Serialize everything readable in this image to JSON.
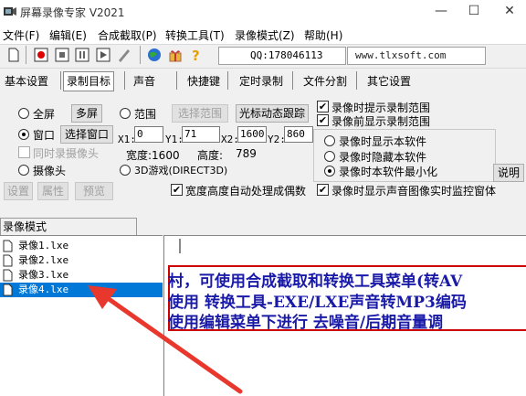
{
  "window": {
    "title": "屏幕录像专家 V2021",
    "min": "—",
    "max": "☐",
    "close": "✕"
  },
  "menu": [
    "文件(F)",
    "编辑(E)",
    "合成截取(P)",
    "转换工具(T)",
    "录像模式(Z)",
    "帮助(H)"
  ],
  "toolbar": {
    "qq": "QQ:178046113",
    "url": "www.tlxsoft.com"
  },
  "tabs": [
    "基本设置",
    "录制目标",
    "声音",
    "快捷键",
    "定时录制",
    "文件分割",
    "其它设置"
  ],
  "active_tab": "录制目标",
  "target": {
    "fullscreen": "全屏",
    "multiscreen": "多屏",
    "range": "范围",
    "select_range": "选择范围",
    "cursor_follow": "光标动态跟踪",
    "window": "窗口",
    "select_window": "选择窗口",
    "x1_label": "X1:",
    "x1": "0",
    "y1_label": "Y1:",
    "y1": "71",
    "x2_label": "X2:",
    "x2": "1600",
    "y2_label": "Y2:",
    "y2": "860",
    "sync_camera": "同时录摄像头",
    "width_label": "宽度:1600",
    "height_label": "高度:",
    "height_value": "789",
    "camera": "摄像头",
    "game3d": "3D游戏(DIRECT3D)",
    "settings": "设置",
    "properties": "属性",
    "preview": "预览",
    "auto_even": "宽度高度自动处理成偶数"
  },
  "options": {
    "prompt_range": "录像时提示录制范围",
    "show_range_before": "录像前显示录制范围",
    "show_soft": "录像时显示本软件",
    "hide_soft": "录像时隐藏本软件",
    "minimize_soft": "录像时本软件最小化",
    "explain": "说明",
    "monitor": "录像时显示声音图像实时监控窗体"
  },
  "mode_label": "录像模式",
  "files": [
    "录像1.lxe",
    "录像2.lxe",
    "录像3.lxe",
    "录像4.lxe"
  ],
  "selected_file": "录像4.lxe",
  "preview_lines": [
    "村，可使用合成截取和转换工具菜单(转AV",
    "使用  转换工具-EXE/LXE声音转MP3编码",
    "使用编辑菜单下进行  去噪音/后期音量调"
  ],
  "colors": {
    "accent": "#0078d7",
    "arrow": "#e8382e",
    "box": "#cc0000",
    "text_blue": "#1a1aa8"
  }
}
